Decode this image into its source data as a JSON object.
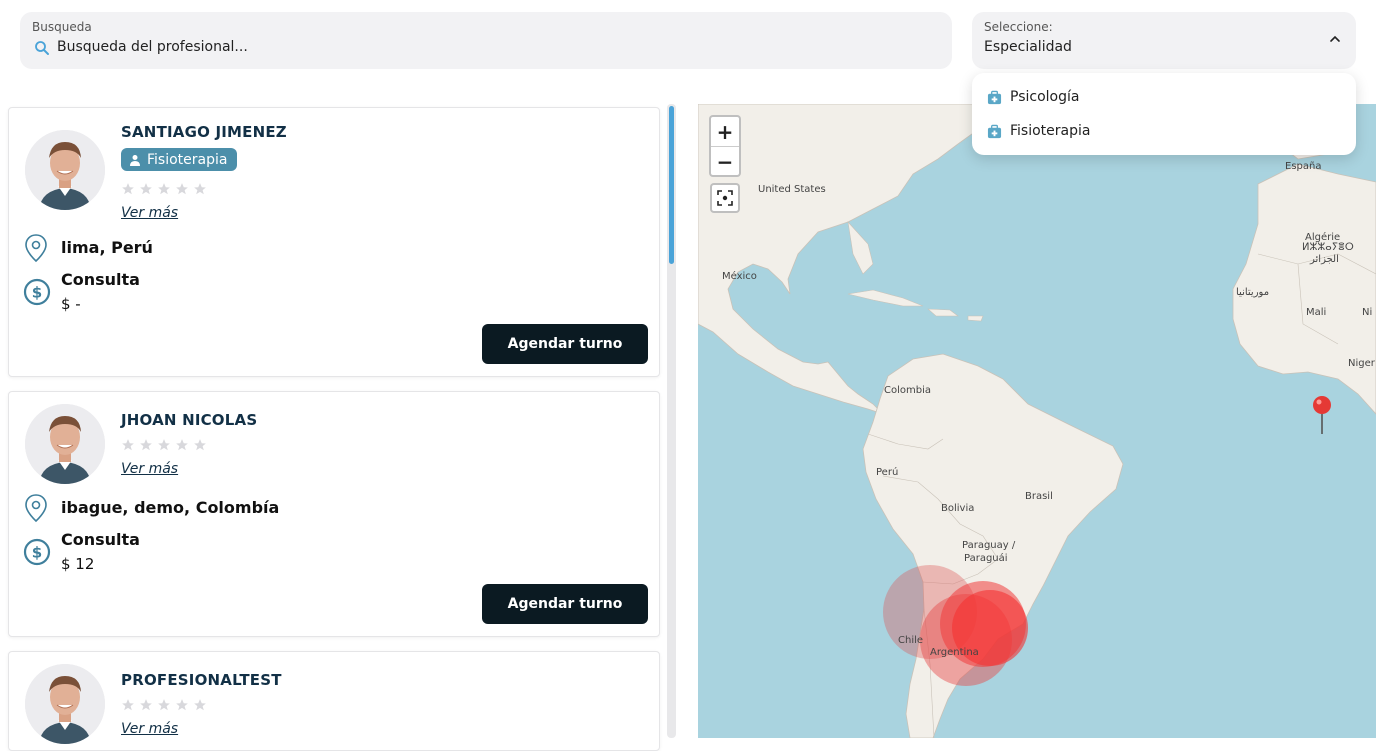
{
  "search": {
    "label": "Busqueda",
    "placeholder": "Busqueda del profesional..."
  },
  "select": {
    "label": "Seleccione:",
    "value": "Especialidad"
  },
  "dropdown": {
    "items": [
      {
        "label": "Psicología"
      },
      {
        "label": "Fisioterapia"
      }
    ]
  },
  "professionals": [
    {
      "name": "SANTIAGO JIMENEZ",
      "specialty": "Fisioterapia",
      "more": "Ver más",
      "location": "lima, Perú",
      "consult_label": "Consulta",
      "price": "$ -",
      "button": "Agendar turno",
      "rating": 0
    },
    {
      "name": "JHOAN NICOLAS",
      "more": "Ver más",
      "location": "ibague, demo, Colombía",
      "consult_label": "Consulta",
      "price": "$ 12",
      "button": "Agendar turno",
      "rating": 0
    },
    {
      "name": "PROFESIONALTEST",
      "more": "Ver más",
      "rating": 0
    }
  ],
  "map": {
    "zoom_in": "+",
    "zoom_out": "−",
    "labels": {
      "united_states": "United States",
      "mexico": "México",
      "colombia": "Colombia",
      "peru": "Perú",
      "bolivia": "Bolivia",
      "brasil": "Brasil",
      "paraguay": "Paraguay /",
      "paraguay2": "Paraguái",
      "chile": "Chile",
      "argentina": "Argentina",
      "espana": "España",
      "algerie": "Algérie",
      "algerie2": "ⵍⵣⵣⴰⵢⴻⵔ",
      "algerie3": "الجزائر",
      "mauritania": "موريتانيا",
      "mali": "Mali",
      "niger": "Niger",
      "ni": "Ni"
    }
  },
  "colors": {
    "accent": "#4c8faa",
    "button": "#0b1a22",
    "water": "#a9d3df",
    "land": "#f2efe9",
    "marker": "#e53935"
  }
}
